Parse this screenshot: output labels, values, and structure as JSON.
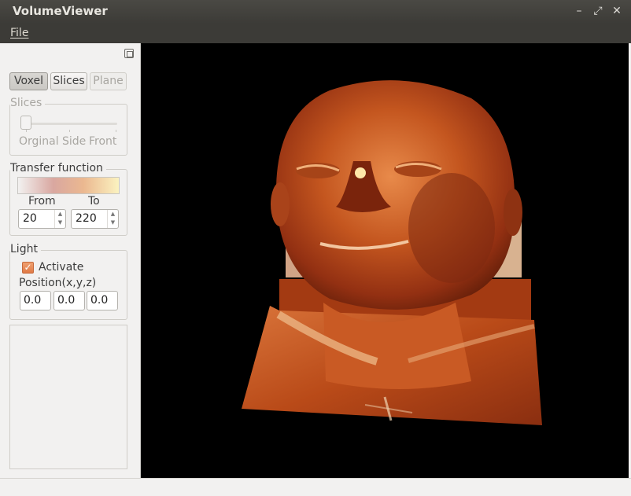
{
  "window": {
    "title": "VolumeViewer",
    "controls": {
      "minimize": "–",
      "maximize": "⤢",
      "close": "✕"
    }
  },
  "menu": {
    "file": "File"
  },
  "tabs": {
    "voxel": "Voxel",
    "slices": "Slices",
    "plane": "Plane",
    "active": "Voxel"
  },
  "slices_group": {
    "title": "Slices",
    "labels": [
      "Orginal",
      "Side",
      "Front"
    ]
  },
  "transfer_group": {
    "title": "Transfer function",
    "from_label": "From",
    "to_label": "To",
    "from_value": "20",
    "to_value": "220"
  },
  "light_group": {
    "title": "Light",
    "activate_label": "Activate",
    "activate_checked": true,
    "position_label": "Position(x,y,z)",
    "x": "0.0",
    "y": "0.0",
    "z": "0.0"
  },
  "colors": {
    "title_bar": "#3c3b37",
    "panel": "#f2f1f0",
    "render_bg": "#000000",
    "skin": "#c0521c"
  }
}
